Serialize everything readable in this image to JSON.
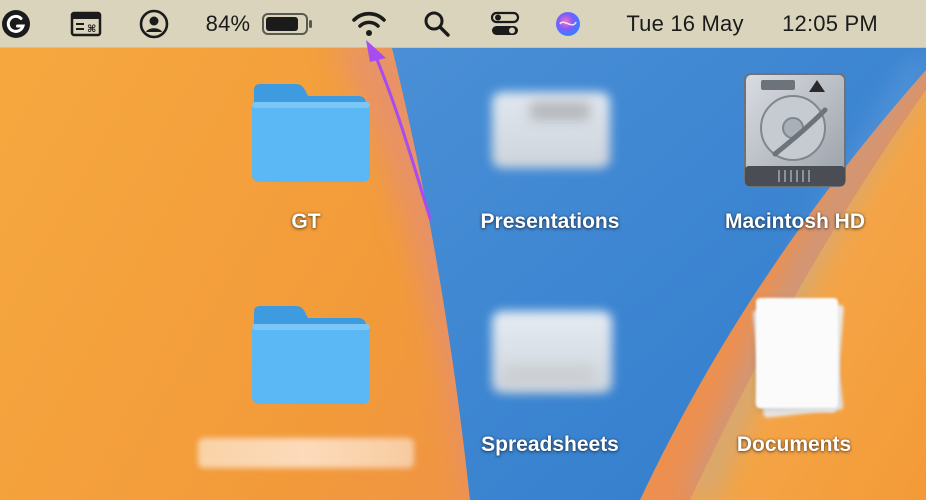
{
  "menubar": {
    "battery_percent_label": "84%",
    "battery_level": 0.84,
    "date": "Tue 16 May",
    "time": "12:05 PM",
    "icons": [
      "grammarly-icon",
      "keyboard-shortcuts-icon",
      "user-account-icon",
      "battery-icon",
      "wifi-icon",
      "spotlight-search-icon",
      "control-center-icon",
      "siri-icon"
    ]
  },
  "desktop": {
    "items": [
      {
        "label": "GT",
        "icon": "folder-icon"
      },
      {
        "label": "Presentations",
        "icon": "blurred-folder-icon"
      },
      {
        "label": "Macintosh HD",
        "icon": "hard-drive-icon"
      },
      {
        "label": "",
        "icon": "folder-icon"
      },
      {
        "label": "Spreadsheets",
        "icon": "blurred-folder-icon"
      },
      {
        "label": "Documents",
        "icon": "documents-stack-icon"
      }
    ]
  },
  "colors": {
    "menubar_bg": "#d9d4bb",
    "wallpaper_orange": "#f39a36",
    "wallpaper_blue": "#3f86d0",
    "folder_blue": "#5cb8f4",
    "arrow_purple": "#a64cf0"
  }
}
